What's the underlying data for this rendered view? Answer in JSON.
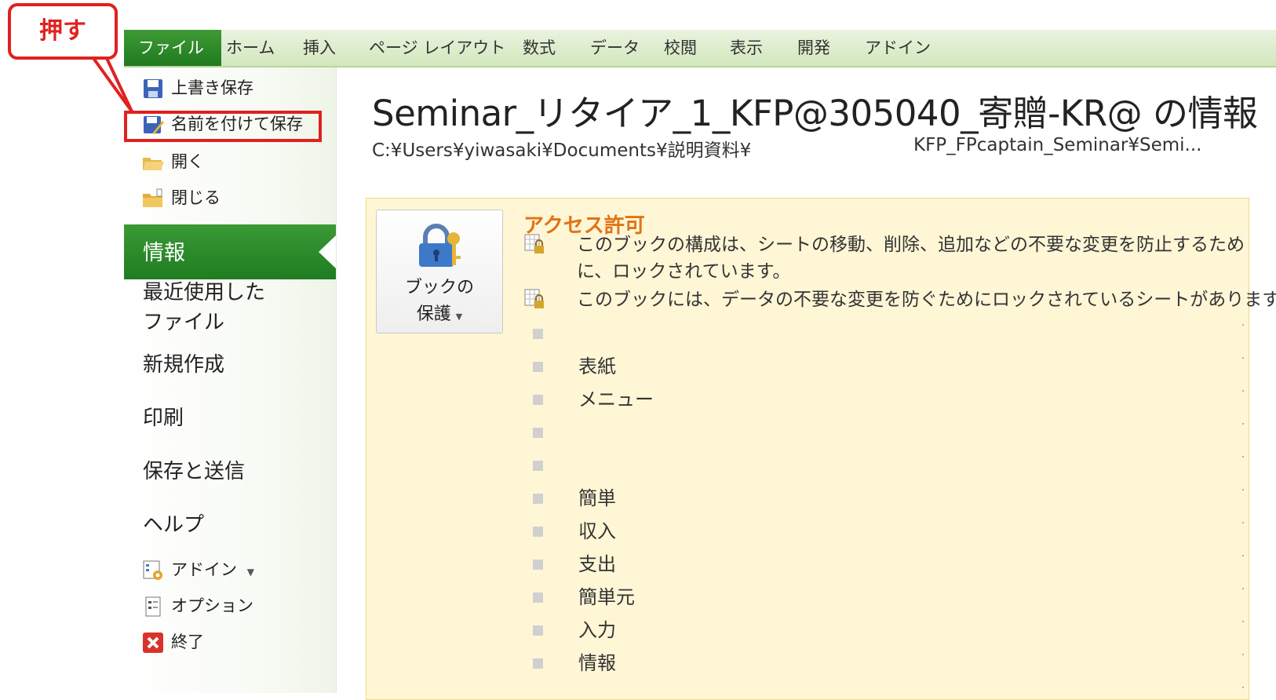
{
  "ribbon": {
    "tabs": [
      "ファイル",
      "ホーム",
      "挿入",
      "ページ レイアウト",
      "数式",
      "データ",
      "校閲",
      "表示",
      "開発",
      "アドイン"
    ]
  },
  "callout": {
    "text": "押す"
  },
  "left_menu": {
    "save": "上書き保存",
    "save_as": "名前を付けて保存",
    "open": "開く",
    "close": "閉じる",
    "info": "情報",
    "recent_line1": "最近使用した",
    "recent_line2": "ファイル",
    "new": "新規作成",
    "print": "印刷",
    "save_send": "保存と送信",
    "help": "ヘルプ",
    "addin": "アドイン",
    "options": "オプション",
    "exit": "終了"
  },
  "info": {
    "title": "Seminar_リタイア_1_KFP@305040_寄贈-KR@ の情報",
    "path_left": "C:¥Users¥yiwasaki¥Documents¥説明資料¥",
    "path_right": "KFP_FPcaptain_Seminar¥Semi...",
    "protect_button_line1": "ブックの",
    "protect_button_line2": "保護",
    "access_heading": "アクセス許可",
    "desc1_line1": "このブックの構成は、シートの移動、削除、追加などの不要な変更を防止するため",
    "desc1_line2": "に、ロックされています。",
    "desc2": "このブックには、データの不要な変更を防ぐためにロックされているシートがあります。",
    "sheets": [
      "",
      "表紙",
      "メニュー",
      "",
      "",
      "簡単",
      "収入",
      "支出",
      "簡単元",
      "入力",
      "情報"
    ]
  },
  "colors": {
    "ribbon_green": "#1f7a1f",
    "accent_orange": "#e07415",
    "callout_red": "#e0211f",
    "panel_bg": "#fff6d6"
  },
  "icons": [
    "save-icon",
    "save-as-icon",
    "open-folder-icon",
    "close-folder-icon",
    "lock-key-icon",
    "lock-sheet-icon",
    "addin-icon",
    "options-icon",
    "exit-icon",
    "dropdown-arrow-icon"
  ]
}
